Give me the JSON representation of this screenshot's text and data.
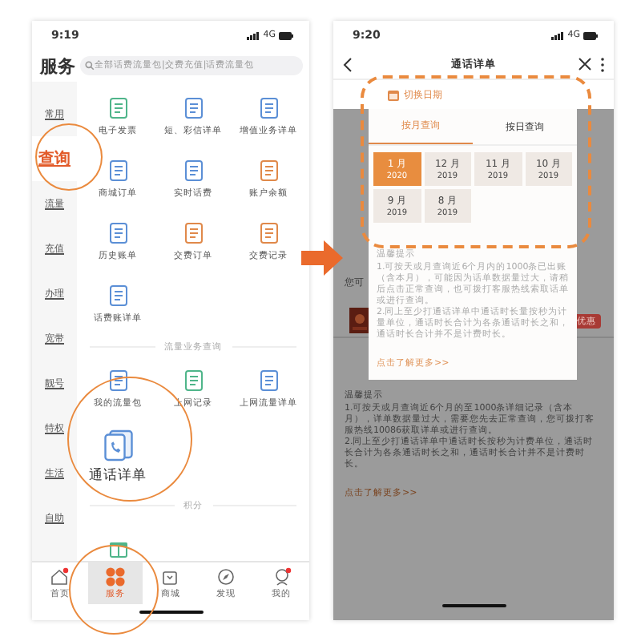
{
  "left_phone": {
    "status_time": "9:19",
    "network": "4G",
    "header_title": "服务",
    "search_placeholder": "全部话费流量包|交费充值|话费流量包",
    "sidebar": [
      {
        "label": "常用",
        "selected": false
      },
      {
        "label": "查询",
        "selected": true
      },
      {
        "label": "流量",
        "selected": false
      },
      {
        "label": "充值",
        "selected": false
      },
      {
        "label": "办理",
        "selected": false
      },
      {
        "label": "宽带",
        "selected": false
      },
      {
        "label": "靓号",
        "selected": false
      },
      {
        "label": "特权",
        "selected": false
      },
      {
        "label": "生活",
        "selected": false
      },
      {
        "label": "自助",
        "selected": false
      }
    ],
    "sections": [
      {
        "items": [
          {
            "kind": "normal",
            "label": "电子发票",
            "color": "#4fb58a"
          },
          {
            "kind": "normal",
            "label": "短、彩信详单",
            "color": "#5b8fd6"
          },
          {
            "kind": "normal",
            "label": "增值业务详单",
            "color": "#5b8fd6"
          },
          {
            "kind": "normal",
            "label": "商城订单",
            "color": "#5b8fd6"
          },
          {
            "kind": "normal",
            "label": "实时话费",
            "color": "#5b8fd6"
          },
          {
            "kind": "normal",
            "label": "账户余额",
            "color": "#e0894a"
          },
          {
            "kind": "normal",
            "label": "历史账单",
            "color": "#5b8fd6"
          },
          {
            "kind": "normal",
            "label": "交费订单",
            "color": "#e0894a"
          },
          {
            "kind": "normal",
            "label": "交费记录",
            "color": "#e0894a"
          },
          {
            "kind": "normal",
            "label": "话费账详单",
            "color": "#5b8fd6"
          }
        ]
      },
      {
        "title": "流量业务查询",
        "items": [
          {
            "kind": "normal",
            "label": "我的流量包",
            "color": "#5b8fd6"
          },
          {
            "kind": "normal",
            "label": "上网记录",
            "color": "#4fb58a"
          },
          {
            "kind": "normal",
            "label": "上网流量详单",
            "color": "#5b8fd6"
          },
          {
            "kind": "large",
            "label": "通话详单",
            "color": "#5b8fd6"
          }
        ]
      },
      {
        "title": "积分",
        "items": [
          {
            "kind": "icon_only",
            "color": "#4fb58a"
          }
        ]
      }
    ],
    "tab_bar": [
      {
        "kind": "home",
        "label": "首页",
        "selected": false,
        "badge": true
      },
      {
        "kind": "services",
        "label": "服务",
        "selected": true,
        "badge": false
      },
      {
        "kind": "shop",
        "label": "商城",
        "selected": false,
        "badge": false
      },
      {
        "kind": "discover",
        "label": "发现",
        "selected": false,
        "badge": false
      },
      {
        "kind": "me",
        "label": "我的",
        "selected": false,
        "badge": true
      }
    ]
  },
  "right_phone": {
    "status_time": "9:20",
    "network": "4G",
    "title": "通话详单",
    "date_switch": "切换日期",
    "background": {
      "cut_text": "您可",
      "badge": "优惠",
      "notice_title": "温馨提示",
      "notices": [
        "1.可按天或月查询近6个月的至1000条详细记录（含本月），详单数据量过大，需要您先去正常查询，您可拨打客服热线10086获取详单或进行查询。",
        "2.同上至少打通话详单中通话时长按秒为计费单位，通话时长合计为各条通话时长之和，通话时长合计并不是计费时长。"
      ],
      "more_link": "点击了解更多>>"
    },
    "popup": {
      "tabs": [
        {
          "label": "按月查询",
          "selected": true
        },
        {
          "label": "按日查询",
          "selected": false
        }
      ],
      "months": [
        {
          "month": "1 月",
          "year": "2020",
          "selected": true
        },
        {
          "month": "12 月",
          "year": "2019",
          "selected": false
        },
        {
          "month": "11 月",
          "year": "2019",
          "selected": false
        },
        {
          "month": "10 月",
          "year": "2019",
          "selected": false
        },
        {
          "month": "9 月",
          "year": "2019",
          "selected": false
        },
        {
          "month": "8 月",
          "year": "2019",
          "selected": false
        }
      ],
      "notice_title": "温馨提示",
      "notices": [
        "1.可按天或月查询近6个月内的1000条已出账（含本月），可能因为话单数据量过大，请稍后点击正常查询，也可拨打客服热线索取话单或进行查询。",
        "2.同上至少打通话详单中通话时长量按秒为计量单位，通话时长合计为各条通话时长之和，通话时长合计并不是计费时长。"
      ],
      "more_link": "点击了解更多>>"
    }
  }
}
